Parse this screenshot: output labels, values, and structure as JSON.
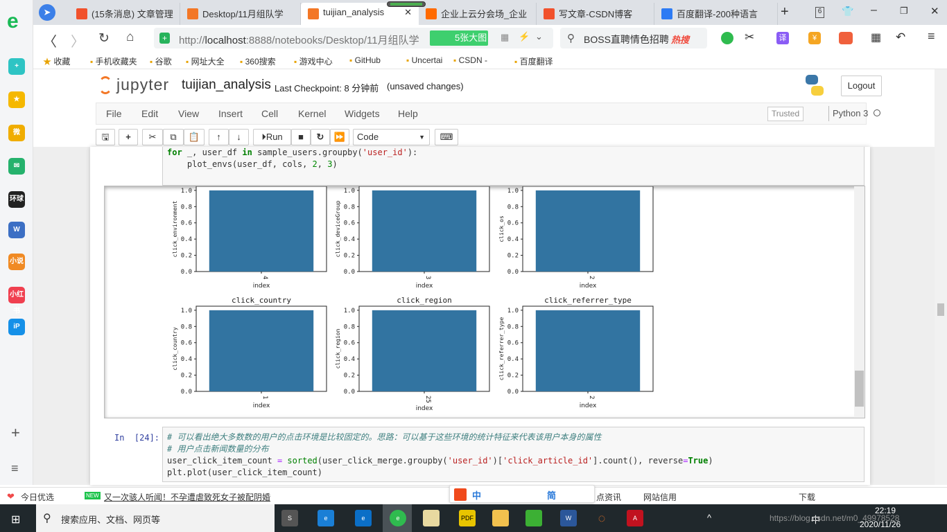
{
  "browser": {
    "tabs": [
      {
        "label": "(15条消息) 文章管理",
        "icon": "csdn-icon",
        "color": "#f1512c"
      },
      {
        "label": "Desktop/11月组队学",
        "icon": "jupyter-icon",
        "color": "#f37726"
      },
      {
        "label": "tuijian_analysis",
        "icon": "notebook-icon",
        "color": "#f37726",
        "active": true
      },
      {
        "label": "企业上云分会场_企业",
        "icon": "aliyun-icon",
        "color": "#ff6a00"
      },
      {
        "label": "写文章-CSDN博客",
        "icon": "csdn-icon",
        "color": "#f1512c"
      },
      {
        "label": "百度翻译-200种语言",
        "icon": "translate-icon",
        "color": "#2d7bf4"
      }
    ],
    "tab_count": "6",
    "url_prefix": "http://",
    "url_host": "localhost",
    "url_rest": ":8888/notebooks/Desktop/11月组队学",
    "image_badge": "5张大图",
    "search_text": "BOSS直聘情色招聘",
    "hot_badge": "热搜",
    "translate_label": "译",
    "bookmarks": [
      "收藏",
      "手机收藏夹",
      "谷歌",
      "网址大全",
      "360搜索",
      "游戏中心",
      "GitHub",
      "Uncertai",
      "CSDN -",
      "百度翻译"
    ]
  },
  "sidebar": {
    "icons": [
      {
        "name": "add-app-icon",
        "color": "#2ec4c4",
        "text": "+"
      },
      {
        "name": "favorites-icon",
        "color": "#f5b800",
        "text": "★"
      },
      {
        "name": "weibo-icon",
        "color": "#f0ad00",
        "text": "微"
      },
      {
        "name": "mail-icon",
        "color": "#25b26d",
        "text": "✉"
      },
      {
        "name": "global-icon",
        "color": "#222",
        "text": "环球"
      },
      {
        "name": "word-icon",
        "color": "#3c6fc4",
        "text": "W"
      },
      {
        "name": "novel-icon",
        "color": "#f08a24",
        "text": "小说"
      },
      {
        "name": "redbook-icon",
        "color": "#f04050",
        "text": "小红书"
      },
      {
        "name": "ip-icon",
        "color": "#1590e8",
        "text": "iP"
      }
    ]
  },
  "jupyter": {
    "logo": "jupyter",
    "notebook_name": "tuijian_analysis",
    "checkpoint": "Last Checkpoint: 8 分钟前",
    "unsaved": "(unsaved changes)",
    "logout": "Logout",
    "menu": [
      "File",
      "Edit",
      "View",
      "Insert",
      "Cell",
      "Kernel",
      "Widgets",
      "Help"
    ],
    "trusted": "Trusted",
    "kernel": "Python 3",
    "run_label": "Run",
    "cell_type": "Code"
  },
  "cell1": {
    "line1": [
      "for",
      " _, user_df ",
      "in",
      " sample_users.groupby(",
      "'user_id'",
      "):"
    ],
    "line2": [
      "    plot_envs(user_df, cols, ",
      "2",
      ", ",
      "3",
      ")"
    ]
  },
  "cell2": {
    "prompt": "In  [24]:",
    "comment1": "# 可以看出绝大多数数的用户的点击环境是比较固定的。思路：可以基于这些环境的统计特征来代表该用户本身的属性",
    "comment2": "# 用户点击新闻数量的分布",
    "line3": [
      "user_click_item_count ",
      "=",
      " ",
      "sorted",
      "(user_click_merge.groupby(",
      "'user_id'",
      ")[",
      "'click_article_id'",
      "].count(), reverse",
      "=",
      "True",
      ")"
    ],
    "line4": "plt.plot(user_click_item_count)"
  },
  "chart_data": [
    {
      "type": "bar",
      "title": "",
      "ylabel": "click_environment",
      "xlabel": "index",
      "categories": [
        "4"
      ],
      "values": [
        1.0
      ],
      "ylim": [
        0,
        1.05
      ],
      "yticks": [
        "0.0",
        "0.2",
        "0.4",
        "0.6",
        "0.8",
        "1.0"
      ],
      "color": "#3274a1"
    },
    {
      "type": "bar",
      "title": "",
      "ylabel": "click_deviceGroup",
      "xlabel": "index",
      "categories": [
        "3"
      ],
      "values": [
        1.0
      ],
      "ylim": [
        0,
        1.05
      ],
      "yticks": [
        "0.0",
        "0.2",
        "0.4",
        "0.6",
        "0.8",
        "1.0"
      ],
      "color": "#3274a1"
    },
    {
      "type": "bar",
      "title": "",
      "ylabel": "click_os",
      "xlabel": "index",
      "categories": [
        "2"
      ],
      "values": [
        1.0
      ],
      "ylim": [
        0,
        1.05
      ],
      "yticks": [
        "0.0",
        "0.2",
        "0.4",
        "0.6",
        "0.8",
        "1.0"
      ],
      "color": "#3274a1"
    },
    {
      "type": "bar",
      "title": "click_country",
      "ylabel": "click_country",
      "xlabel": "index",
      "categories": [
        "1"
      ],
      "values": [
        1.0
      ],
      "ylim": [
        0,
        1.05
      ],
      "yticks": [
        "0.0",
        "0.2",
        "0.4",
        "0.6",
        "0.8",
        "1.0"
      ],
      "color": "#3274a1"
    },
    {
      "type": "bar",
      "title": "click_region",
      "ylabel": "click_region",
      "xlabel": "index",
      "categories": [
        "25"
      ],
      "values": [
        1.0
      ],
      "ylim": [
        0,
        1.05
      ],
      "yticks": [
        "0.0",
        "0.2",
        "0.4",
        "0.6",
        "0.8",
        "1.0"
      ],
      "color": "#3274a1"
    },
    {
      "type": "bar",
      "title": "click_referrer_type",
      "ylabel": "click_referrer_type",
      "xlabel": "index",
      "categories": [
        "2"
      ],
      "values": [
        1.0
      ],
      "ylim": [
        0,
        1.05
      ],
      "yticks": [
        "0.0",
        "0.2",
        "0.4",
        "0.6",
        "0.8",
        "1.0"
      ],
      "color": "#3274a1"
    }
  ],
  "statusbar": {
    "left1": "今日优选",
    "news_badge": "NEW",
    "news": "又一次骇人听闻！不孕遭虐致死女子被配阴婚",
    "ime": [
      "中",
      "简"
    ],
    "right": [
      "点资讯",
      "网站信用",
      "下载"
    ]
  },
  "taskbar": {
    "search": "搜索应用、文档、网页等",
    "time": "22:19",
    "date": "2020/11/26",
    "lang": "中",
    "watermark": "https://blog.csdn.net/m0_49978528"
  }
}
